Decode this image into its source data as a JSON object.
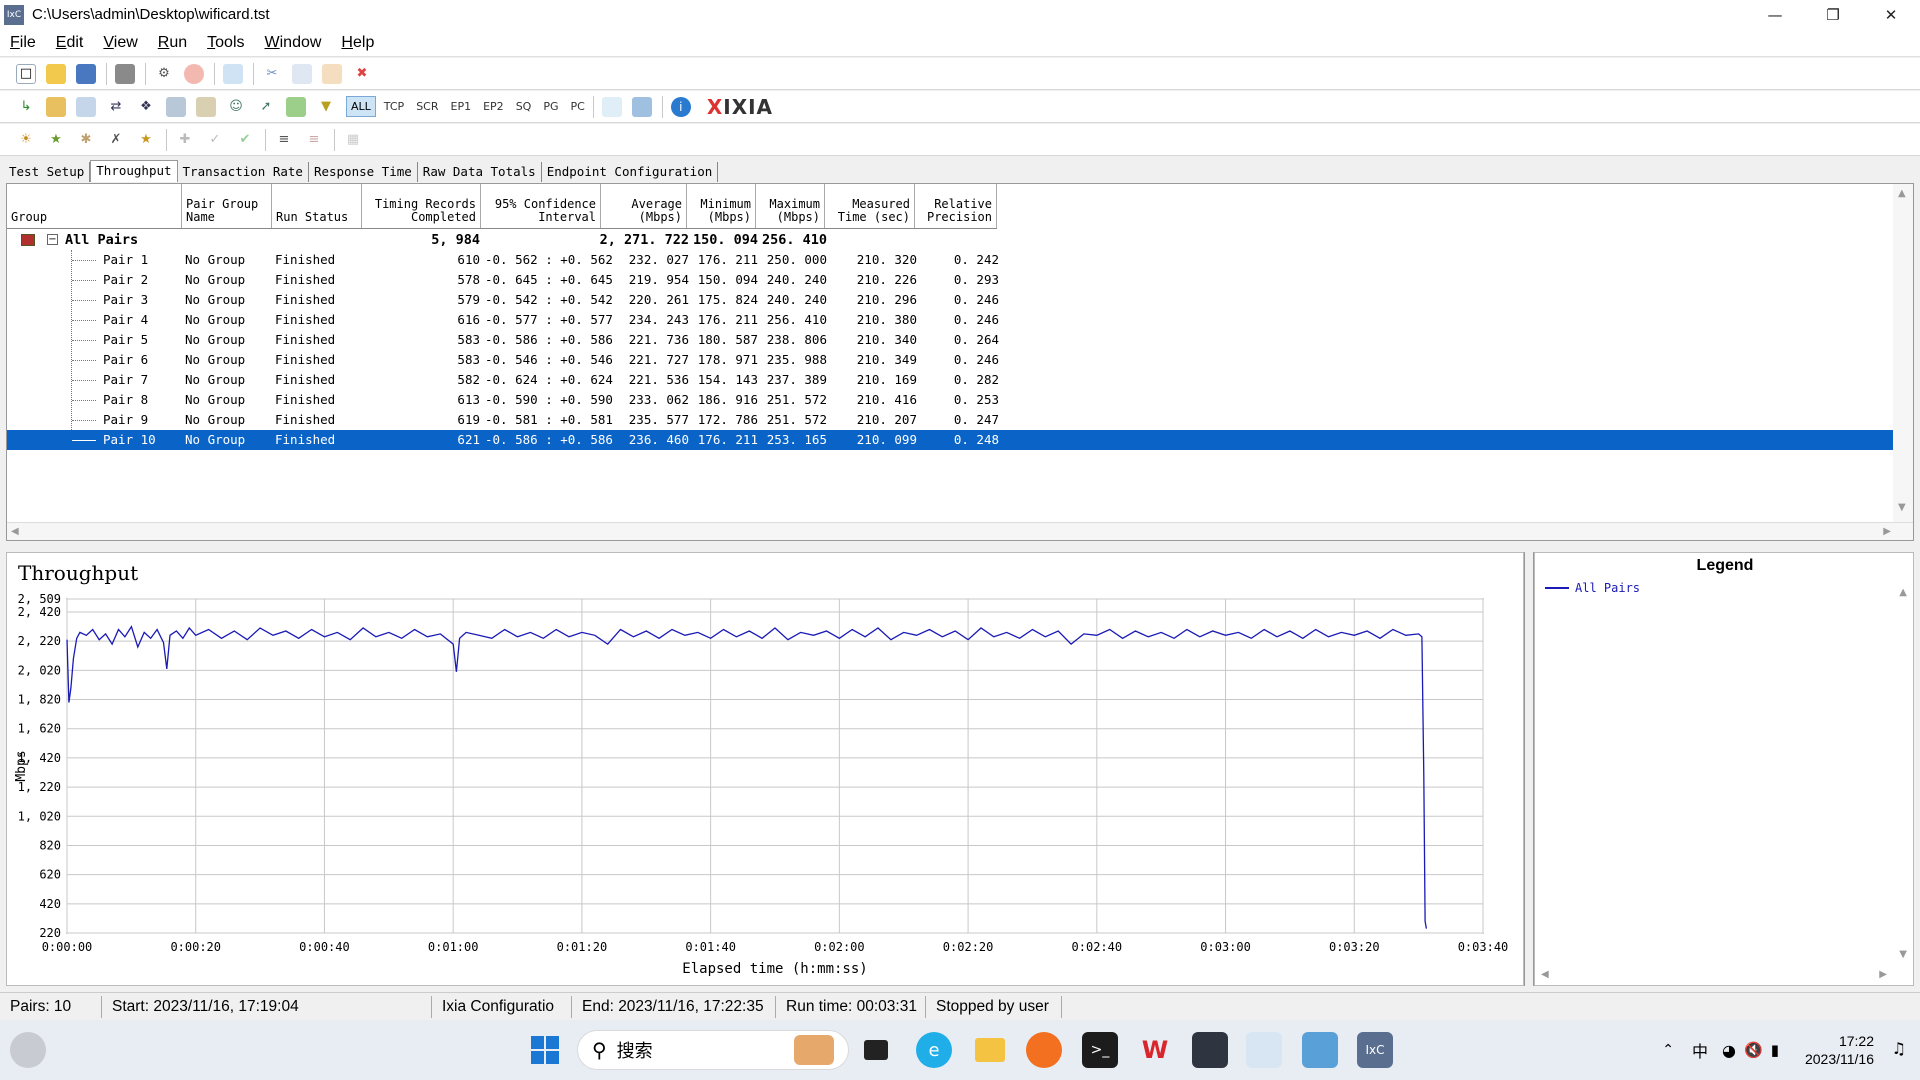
{
  "window": {
    "app_icon": "IxC",
    "title": "C:\\Users\\admin\\Desktop\\wificard.tst"
  },
  "menu": [
    {
      "label": "File",
      "u": "F",
      "rest": "ile"
    },
    {
      "label": "Edit",
      "u": "E",
      "rest": "dit"
    },
    {
      "label": "View",
      "u": "V",
      "rest": "iew"
    },
    {
      "label": "Run",
      "u": "R",
      "rest": "un"
    },
    {
      "label": "Tools",
      "u": "T",
      "rest": "ools"
    },
    {
      "label": "Window",
      "u": "W",
      "rest": "indow"
    },
    {
      "label": "Help",
      "u": "H",
      "rest": "elp"
    }
  ],
  "protocol_filters": [
    "ALL",
    "TCP",
    "SCR",
    "EP1",
    "EP2",
    "SQ",
    "PG",
    "PC"
  ],
  "active_protocol": "ALL",
  "brand": {
    "x": "X",
    "rest": "IXIA"
  },
  "tabs": [
    "Test Setup",
    "Throughput",
    "Transaction Rate",
    "Response Time",
    "Raw Data Totals",
    "Endpoint Configuration"
  ],
  "active_tab": "Throughput",
  "grid": {
    "headers": {
      "group": "Group",
      "pair_group_name": "Pair Group\nName",
      "run_status": "Run Status",
      "timing_records": "Timing Records\nCompleted",
      "confidence": "95% Confidence\nInterval",
      "average": "Average\n(Mbps)",
      "minimum": "Minimum\n(Mbps)",
      "maximum": "Maximum\n(Mbps)",
      "measured_time": "Measured\nTime (sec)",
      "relative_precision": "Relative\nPrecision"
    },
    "summary": {
      "label": "All Pairs",
      "records": "5, 984",
      "average": "2, 271. 722",
      "minimum": "150. 094",
      "maximum": "256. 410"
    },
    "rows": [
      {
        "pair": "Pair 1",
        "group": "No Group",
        "status": "Finished",
        "records": "610",
        "ci": "-0. 562 : +0. 562",
        "avg": "232. 027",
        "min": "176. 211",
        "max": "250. 000",
        "time": "210. 320",
        "prec": "0. 242"
      },
      {
        "pair": "Pair 2",
        "group": "No Group",
        "status": "Finished",
        "records": "578",
        "ci": "-0. 645 : +0. 645",
        "avg": "219. 954",
        "min": "150. 094",
        "max": "240. 240",
        "time": "210. 226",
        "prec": "0. 293"
      },
      {
        "pair": "Pair 3",
        "group": "No Group",
        "status": "Finished",
        "records": "579",
        "ci": "-0. 542 : +0. 542",
        "avg": "220. 261",
        "min": "175. 824",
        "max": "240. 240",
        "time": "210. 296",
        "prec": "0. 246"
      },
      {
        "pair": "Pair 4",
        "group": "No Group",
        "status": "Finished",
        "records": "616",
        "ci": "-0. 577 : +0. 577",
        "avg": "234. 243",
        "min": "176. 211",
        "max": "256. 410",
        "time": "210. 380",
        "prec": "0. 246"
      },
      {
        "pair": "Pair 5",
        "group": "No Group",
        "status": "Finished",
        "records": "583",
        "ci": "-0. 586 : +0. 586",
        "avg": "221. 736",
        "min": "180. 587",
        "max": "238. 806",
        "time": "210. 340",
        "prec": "0. 264"
      },
      {
        "pair": "Pair 6",
        "group": "No Group",
        "status": "Finished",
        "records": "583",
        "ci": "-0. 546 : +0. 546",
        "avg": "221. 727",
        "min": "178. 971",
        "max": "235. 988",
        "time": "210. 349",
        "prec": "0. 246"
      },
      {
        "pair": "Pair 7",
        "group": "No Group",
        "status": "Finished",
        "records": "582",
        "ci": "-0. 624 : +0. 624",
        "avg": "221. 536",
        "min": "154. 143",
        "max": "237. 389",
        "time": "210. 169",
        "prec": "0. 282"
      },
      {
        "pair": "Pair 8",
        "group": "No Group",
        "status": "Finished",
        "records": "613",
        "ci": "-0. 590 : +0. 590",
        "avg": "233. 062",
        "min": "186. 916",
        "max": "251. 572",
        "time": "210. 416",
        "prec": "0. 253"
      },
      {
        "pair": "Pair 9",
        "group": "No Group",
        "status": "Finished",
        "records": "619",
        "ci": "-0. 581 : +0. 581",
        "avg": "235. 577",
        "min": "172. 786",
        "max": "251. 572",
        "time": "210. 207",
        "prec": "0. 247"
      },
      {
        "pair": "Pair 10",
        "group": "No Group",
        "status": "Finished",
        "records": "621",
        "ci": "-0. 586 : +0. 586",
        "avg": "236. 460",
        "min": "176. 211",
        "max": "253. 165",
        "time": "210. 099",
        "prec": "0. 248"
      }
    ],
    "selected_row": "Pair 10"
  },
  "chart_data": {
    "type": "line",
    "title": "Throughput",
    "xlabel": "Elapsed time (h:mm:ss)",
    "ylabel": "Mbps",
    "xlim": [
      0,
      220
    ],
    "ylim": [
      220,
      2509
    ],
    "x_ticks": [
      "0:00:00",
      "0:00:20",
      "0:00:40",
      "0:01:00",
      "0:01:20",
      "0:01:40",
      "0:02:00",
      "0:02:20",
      "0:02:40",
      "0:03:00",
      "0:03:20",
      "0:03:40"
    ],
    "y_ticks": [
      "220",
      "420",
      "620",
      "820",
      "1, 020",
      "1, 220",
      "1, 420",
      "1, 620",
      "1, 820",
      "2, 020",
      "2, 220",
      "2, 420",
      "2, 509"
    ],
    "grid": true,
    "series": [
      {
        "name": "All Pairs",
        "color": "#1a1ab5",
        "x": [
          0,
          0.3,
          0.6,
          1,
          1.5,
          2,
          3,
          4,
          5,
          6,
          7,
          8,
          9,
          10,
          11,
          12,
          13,
          14,
          15,
          15.5,
          16,
          17,
          18,
          19,
          20,
          22,
          24,
          26,
          28,
          30,
          32,
          34,
          36,
          38,
          40,
          42,
          44,
          46,
          48,
          50,
          52,
          54,
          56,
          58,
          60,
          60.5,
          61,
          62,
          64,
          66,
          68,
          70,
          72,
          74,
          76,
          78,
          80,
          82,
          84,
          86,
          88,
          90,
          92,
          94,
          96,
          98,
          100,
          102,
          104,
          106,
          108,
          110,
          112,
          114,
          116,
          118,
          120,
          122,
          124,
          126,
          128,
          130,
          132,
          134,
          136,
          138,
          140,
          142,
          144,
          146,
          148,
          150,
          152,
          154,
          156,
          158,
          160,
          162,
          164,
          166,
          168,
          170,
          172,
          174,
          176,
          178,
          180,
          182,
          184,
          186,
          188,
          190,
          192,
          194,
          196,
          198,
          200,
          202,
          204,
          206,
          208,
          210,
          210.5,
          210.8,
          211,
          211.2
        ],
        "values": [
          2230,
          1800,
          1900,
          2100,
          2240,
          2280,
          2260,
          2300,
          2230,
          2270,
          2200,
          2300,
          2250,
          2320,
          2180,
          2280,
          2240,
          2300,
          2210,
          2030,
          2260,
          2290,
          2240,
          2310,
          2260,
          2300,
          2240,
          2290,
          2230,
          2310,
          2260,
          2290,
          2240,
          2300,
          2250,
          2280,
          2230,
          2310,
          2250,
          2280,
          2240,
          2300,
          2250,
          2270,
          2200,
          2010,
          2240,
          2280,
          2260,
          2240,
          2300,
          2250,
          2280,
          2240,
          2300,
          2250,
          2280,
          2260,
          2200,
          2300,
          2250,
          2290,
          2240,
          2300,
          2260,
          2280,
          2240,
          2300,
          2250,
          2290,
          2240,
          2310,
          2230,
          2280,
          2260,
          2290,
          2240,
          2300,
          2250,
          2310,
          2230,
          2280,
          2260,
          2300,
          2250,
          2290,
          2230,
          2310,
          2250,
          2280,
          2240,
          2300,
          2250,
          2290,
          2200,
          2270,
          2260,
          2300,
          2240,
          2290,
          2250,
          2280,
          2240,
          2300,
          2250,
          2290,
          2260,
          2280,
          2240,
          2300,
          2250,
          2290,
          2240,
          2300,
          2250,
          2280,
          2260,
          2290,
          2240,
          2300,
          2260,
          2270,
          2250,
          1300,
          300,
          250
        ]
      }
    ],
    "legend_position": "right"
  },
  "legend": {
    "title": "Legend",
    "items": [
      "All Pairs"
    ]
  },
  "status": {
    "pairs": "Pairs: 10",
    "start": "Start: 2023/11/16, 17:19:04",
    "config": "Ixia Configuratio",
    "end": "End: 2023/11/16, 17:22:35",
    "run_time": "Run time: 00:03:31",
    "state": "Stopped by user"
  },
  "taskbar": {
    "search_placeholder": "搜索",
    "ime": "中",
    "time": "17:22",
    "date": "2023/11/16"
  }
}
